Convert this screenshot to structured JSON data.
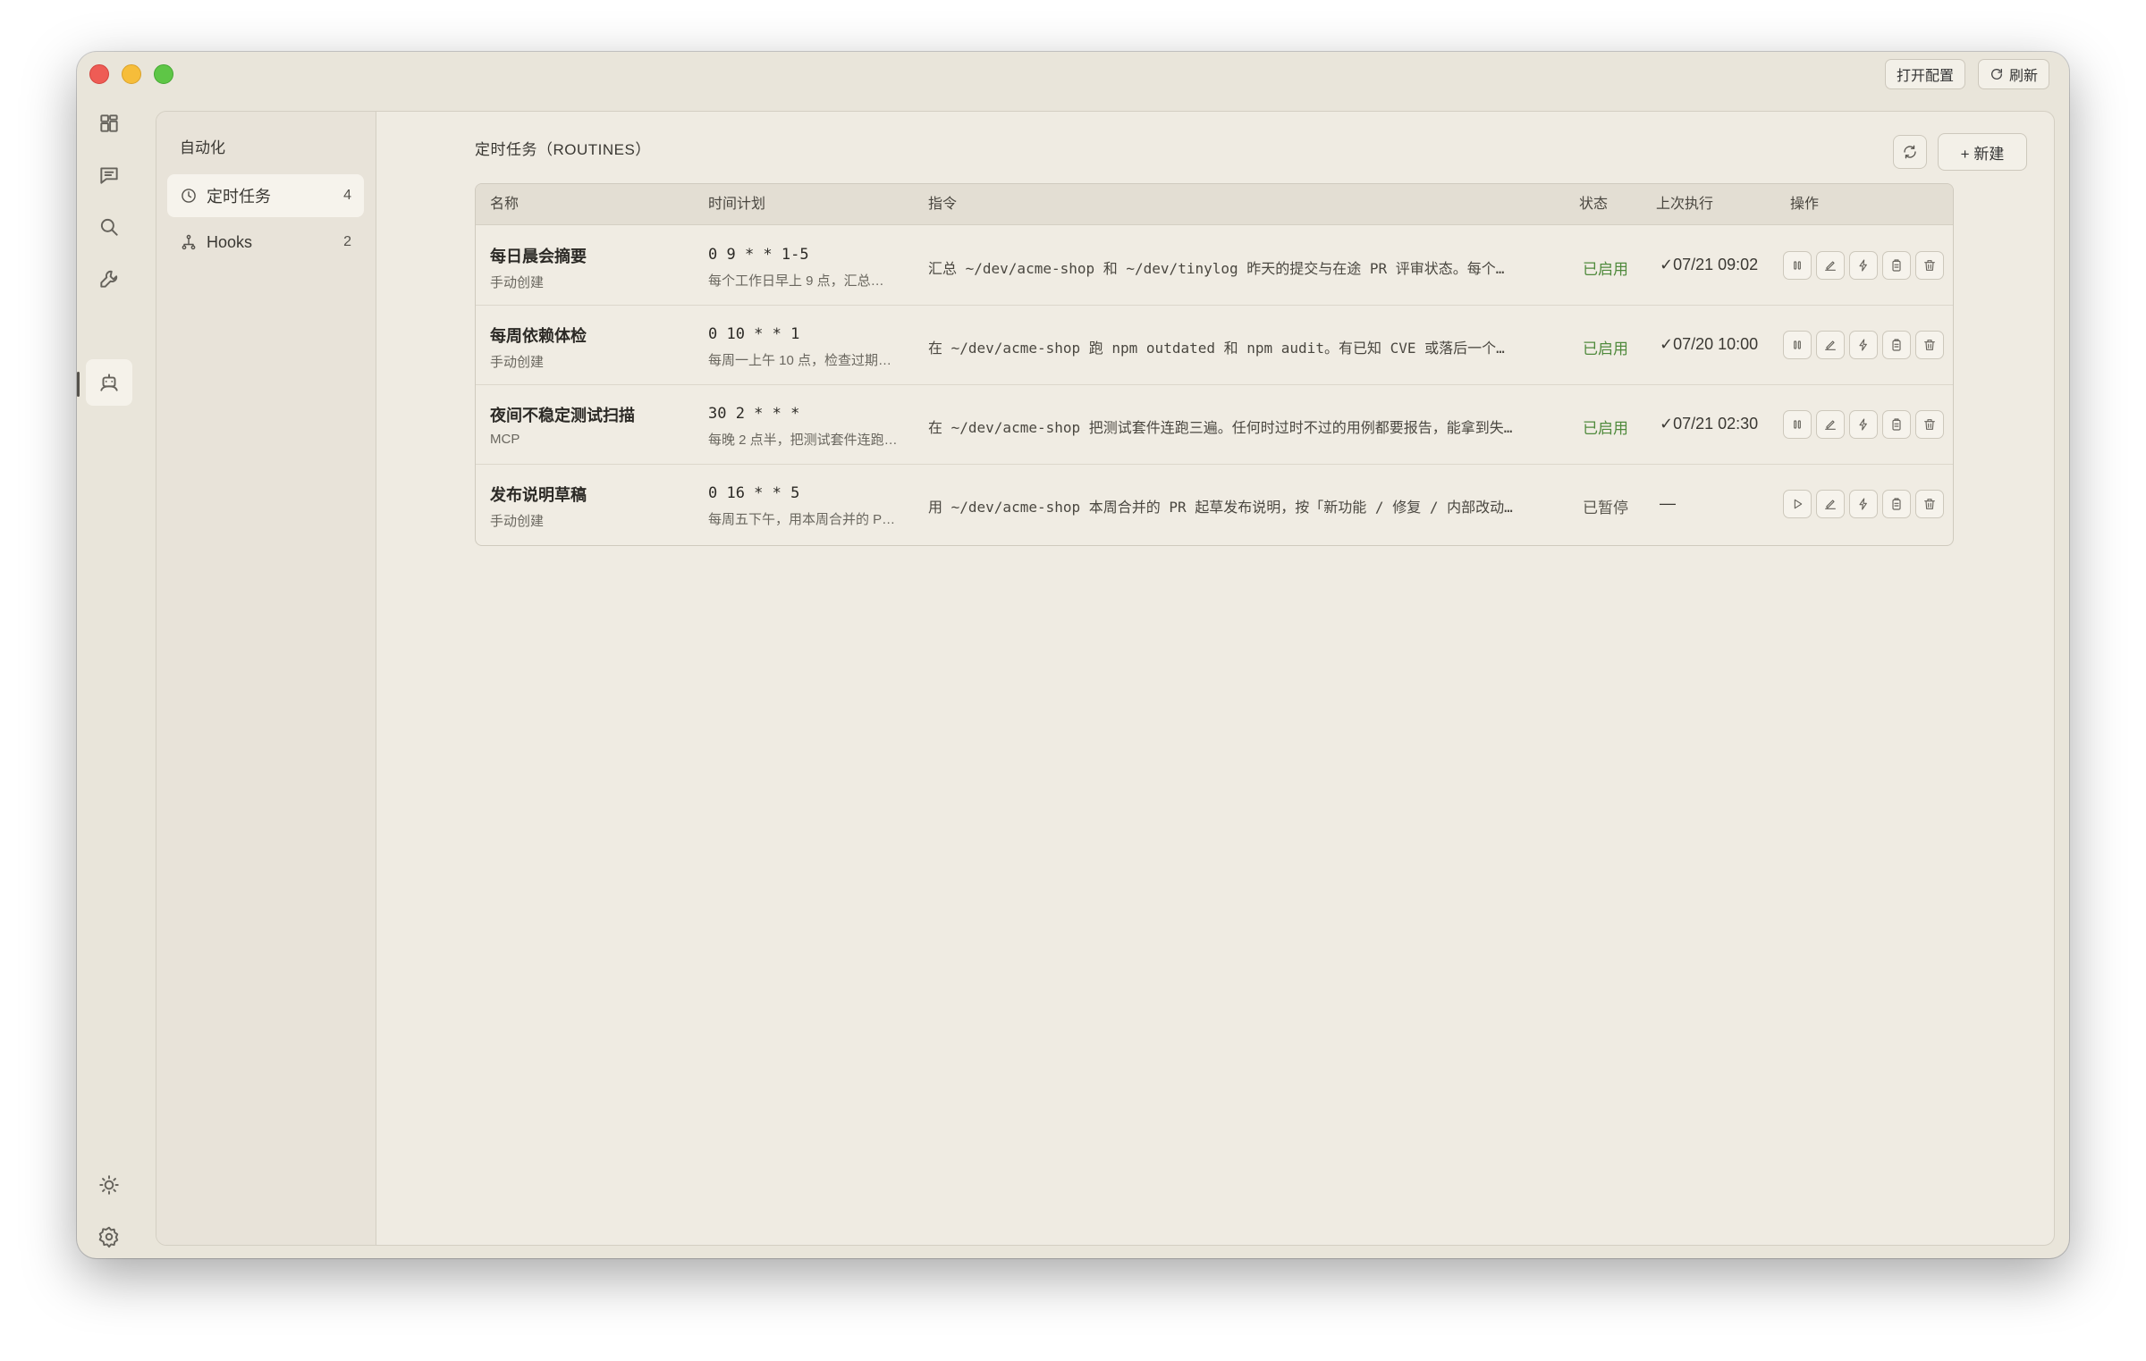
{
  "titlebar": {
    "open_config_label": "打开配置",
    "refresh_label": "刷新"
  },
  "subnav": {
    "title": "自动化",
    "items": [
      {
        "label": "定时任务",
        "count": "4"
      },
      {
        "label": "Hooks",
        "count": "2"
      }
    ]
  },
  "main": {
    "section_title": "定时任务（ROUTINES）",
    "new_button_label": "+ 新建",
    "columns": [
      "名称",
      "时间计划",
      "指令",
      "状态",
      "上次执行",
      "操作"
    ],
    "rows": [
      {
        "name": "每日晨会摘要",
        "source": "手动创建",
        "cron": "0 9 * * 1-5",
        "schedule_desc": "每个工作日早上 9 点，汇总…",
        "command": "汇总 ~/dev/acme-shop 和 ~/dev/tinylog 昨天的提交与在途 PR 评审状态。每个…",
        "status": "已启用",
        "last_run": "✓07/21 09:02"
      },
      {
        "name": "每周依赖体检",
        "source": "手动创建",
        "cron": "0 10 * * 1",
        "schedule_desc": "每周一上午 10 点，检查过期…",
        "command": "在 ~/dev/acme-shop 跑 npm outdated 和 npm audit。有已知 CVE 或落后一个…",
        "status": "已启用",
        "last_run": "✓07/20 10:00"
      },
      {
        "name": "夜间不稳定测试扫描",
        "source": "MCP",
        "cron": "30 2 * * *",
        "schedule_desc": "每晚 2 点半，把测试套件连跑…",
        "command": "在 ~/dev/acme-shop 把测试套件连跑三遍。任何时过时不过的用例都要报告，能拿到失…",
        "status": "已启用",
        "last_run": "✓07/21 02:30"
      },
      {
        "name": "发布说明草稿",
        "source": "手动创建",
        "cron": "0 16 * * 5",
        "schedule_desc": "每周五下午，用本周合并的 P…",
        "command": "用 ~/dev/acme-shop 本周合并的 PR 起草发布说明，按「新功能 / 修复 / 内部改动…",
        "status": "已暂停",
        "last_run": "—"
      }
    ]
  },
  "colors": {
    "window_bg": "#e9e5da",
    "enabled_green": "#4f8a3c",
    "close_red": "#ee5c55",
    "minimize_yellow": "#f6bd3a",
    "zoom_green": "#5ec646"
  },
  "icons": {
    "rail": [
      "dashboard-icon",
      "chat-icon",
      "search-icon",
      "wrench-icon",
      "robot-icon",
      "sun-icon",
      "gear-icon"
    ],
    "row_actions": [
      "pause-icon",
      "edit-icon",
      "bolt-icon",
      "clipboard-icon",
      "trash-icon"
    ]
  }
}
